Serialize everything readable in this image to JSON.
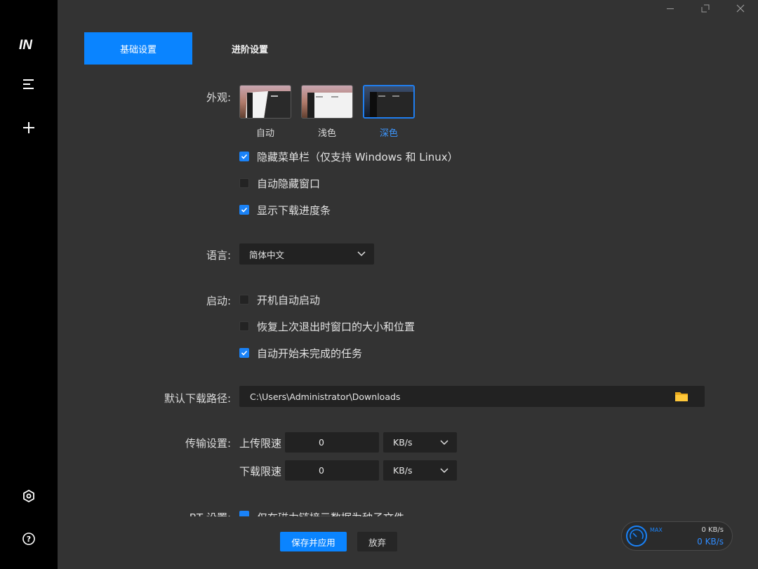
{
  "sidebar": {
    "logo": "IN",
    "items": [
      {
        "name": "menu-icon"
      },
      {
        "name": "plus-icon"
      },
      {
        "name": "settings-hex-icon"
      },
      {
        "name": "help-icon"
      }
    ]
  },
  "window_controls": [
    "minimize-icon",
    "maximize-icon",
    "close-icon"
  ],
  "tabs": [
    {
      "label": "基础设置",
      "active": true
    },
    {
      "label": "进阶设置",
      "active": false
    }
  ],
  "appearance": {
    "label": "外观:",
    "themes": [
      {
        "label": "自动",
        "selected": false
      },
      {
        "label": "浅色",
        "selected": false
      },
      {
        "label": "深色",
        "selected": true
      }
    ],
    "options": [
      {
        "label": "隐藏菜单栏（仅支持 Windows 和 Linux）",
        "checked": true
      },
      {
        "label": "自动隐藏窗口",
        "checked": false
      },
      {
        "label": "显示下载进度条",
        "checked": true
      }
    ]
  },
  "language": {
    "label": "语言:",
    "value": "简体中文"
  },
  "startup": {
    "label": "启动:",
    "options": [
      {
        "label": "开机自动启动",
        "checked": false
      },
      {
        "label": "恢复上次退出时窗口的大小和位置",
        "checked": false
      },
      {
        "label": "自动开始未完成的任务",
        "checked": true
      }
    ]
  },
  "download_path": {
    "label": "默认下载路径:",
    "value": "C:\\Users\\Administrator\\Downloads"
  },
  "transfer": {
    "label": "传输设置:",
    "upload_label": "上传限速",
    "upload_value": "0",
    "upload_unit": "KB/s",
    "download_label": "下载限速",
    "download_value": "0",
    "download_unit": "KB/s"
  },
  "bt": {
    "label": "BT 设置:",
    "option": "仅在磁力链接元数据为种子文件"
  },
  "actions": {
    "save": "保存并应用",
    "discard": "放弃"
  },
  "speed_widget": {
    "max_label": "MAX",
    "upload": "0 KB/s",
    "download": "0 KB/s"
  },
  "colors": {
    "accent": "#0a84ff",
    "rail": "#000000",
    "background": "#333333"
  }
}
